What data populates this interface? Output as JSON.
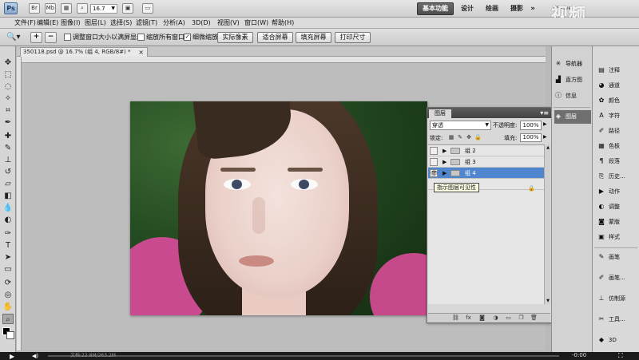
{
  "app": {
    "logo": "Ps",
    "zoom_value": "16.7",
    "workspaces": [
      "基本功能",
      "设计",
      "绘画",
      "摄影"
    ],
    "more": "»",
    "cs_live": "CS Live",
    "watermark": "视频"
  },
  "menu": [
    "文件(F)",
    "编辑(E)",
    "图像(I)",
    "图层(L)",
    "选择(S)",
    "滤镜(T)",
    "分析(A)",
    "3D(D)",
    "视图(V)",
    "窗口(W)",
    "帮助(H)"
  ],
  "options": {
    "zoom_in": "+",
    "zoom_out": "−",
    "resize_windows_label": "调整窗口大小以满屏显示",
    "zoom_all_label": "缩放所有窗口",
    "scrubby_label": "细微缩放",
    "scrubby_checked": "✓",
    "btn_actual": "实际像素",
    "btn_fit": "适合屏幕",
    "btn_fill": "填充屏幕",
    "btn_print": "打印尺寸"
  },
  "document": {
    "tab_title": "350118.psd @ 16.7% (组 4, RGB/8#) *",
    "close": "×"
  },
  "layers_panel": {
    "tab_label": "图层",
    "menu": "▾≡",
    "blend_mode": "穿透",
    "opacity_label": "不透明度:",
    "opacity_value": "100%",
    "lock_label": "锁定:",
    "fill_label": "填充:",
    "fill_value": "100%",
    "layers": [
      {
        "name": "组 2",
        "visible": false,
        "selected": false
      },
      {
        "name": "组 3",
        "visible": false,
        "selected": false
      },
      {
        "name": "组 4",
        "visible": true,
        "selected": true
      }
    ],
    "tooltip": "指示图层可见性"
  },
  "dock_icons": [
    {
      "label": "导航器",
      "icon": "compass-icon"
    },
    {
      "label": "直方图",
      "icon": "histogram-icon"
    },
    {
      "label": "信息",
      "icon": "info-icon"
    },
    {
      "label": "图层",
      "icon": "layers-icon",
      "selected": true
    }
  ],
  "dock_panels": [
    {
      "label": "注释",
      "icon": "note-icon"
    },
    {
      "label": "通道",
      "icon": "channels-icon"
    },
    {
      "label": "颜色",
      "icon": "color-icon"
    },
    {
      "label": "字符",
      "icon": "character-icon"
    },
    {
      "label": "路径",
      "icon": "paths-icon"
    },
    {
      "label": "色板",
      "icon": "swatches-icon"
    },
    {
      "label": "段落",
      "icon": "paragraph-icon"
    },
    {
      "label": "历史...",
      "icon": "history-icon"
    },
    {
      "label": "动作",
      "icon": "actions-icon"
    },
    {
      "label": "调整",
      "icon": "adjust-icon"
    },
    {
      "label": "蒙版",
      "icon": "mask-icon"
    },
    {
      "label": "样式",
      "icon": "styles-icon"
    },
    {
      "label": "画笔",
      "icon": "brush-icon"
    },
    {
      "label": "画笔...",
      "icon": "brush-presets-icon"
    },
    {
      "label": "仿制源",
      "icon": "clone-source-icon"
    },
    {
      "label": "工具...",
      "icon": "tool-presets-icon"
    },
    {
      "label": "3D",
      "icon": "3d-icon"
    }
  ],
  "video": {
    "status": "文档:22.8M/263.2M",
    "time": "-0:00",
    "progress_fraction": 0.0
  },
  "colors": {
    "selection_blue": "#4f86cd",
    "workspace_active": "#555555",
    "tooltip_bg": "#ffffe6"
  }
}
